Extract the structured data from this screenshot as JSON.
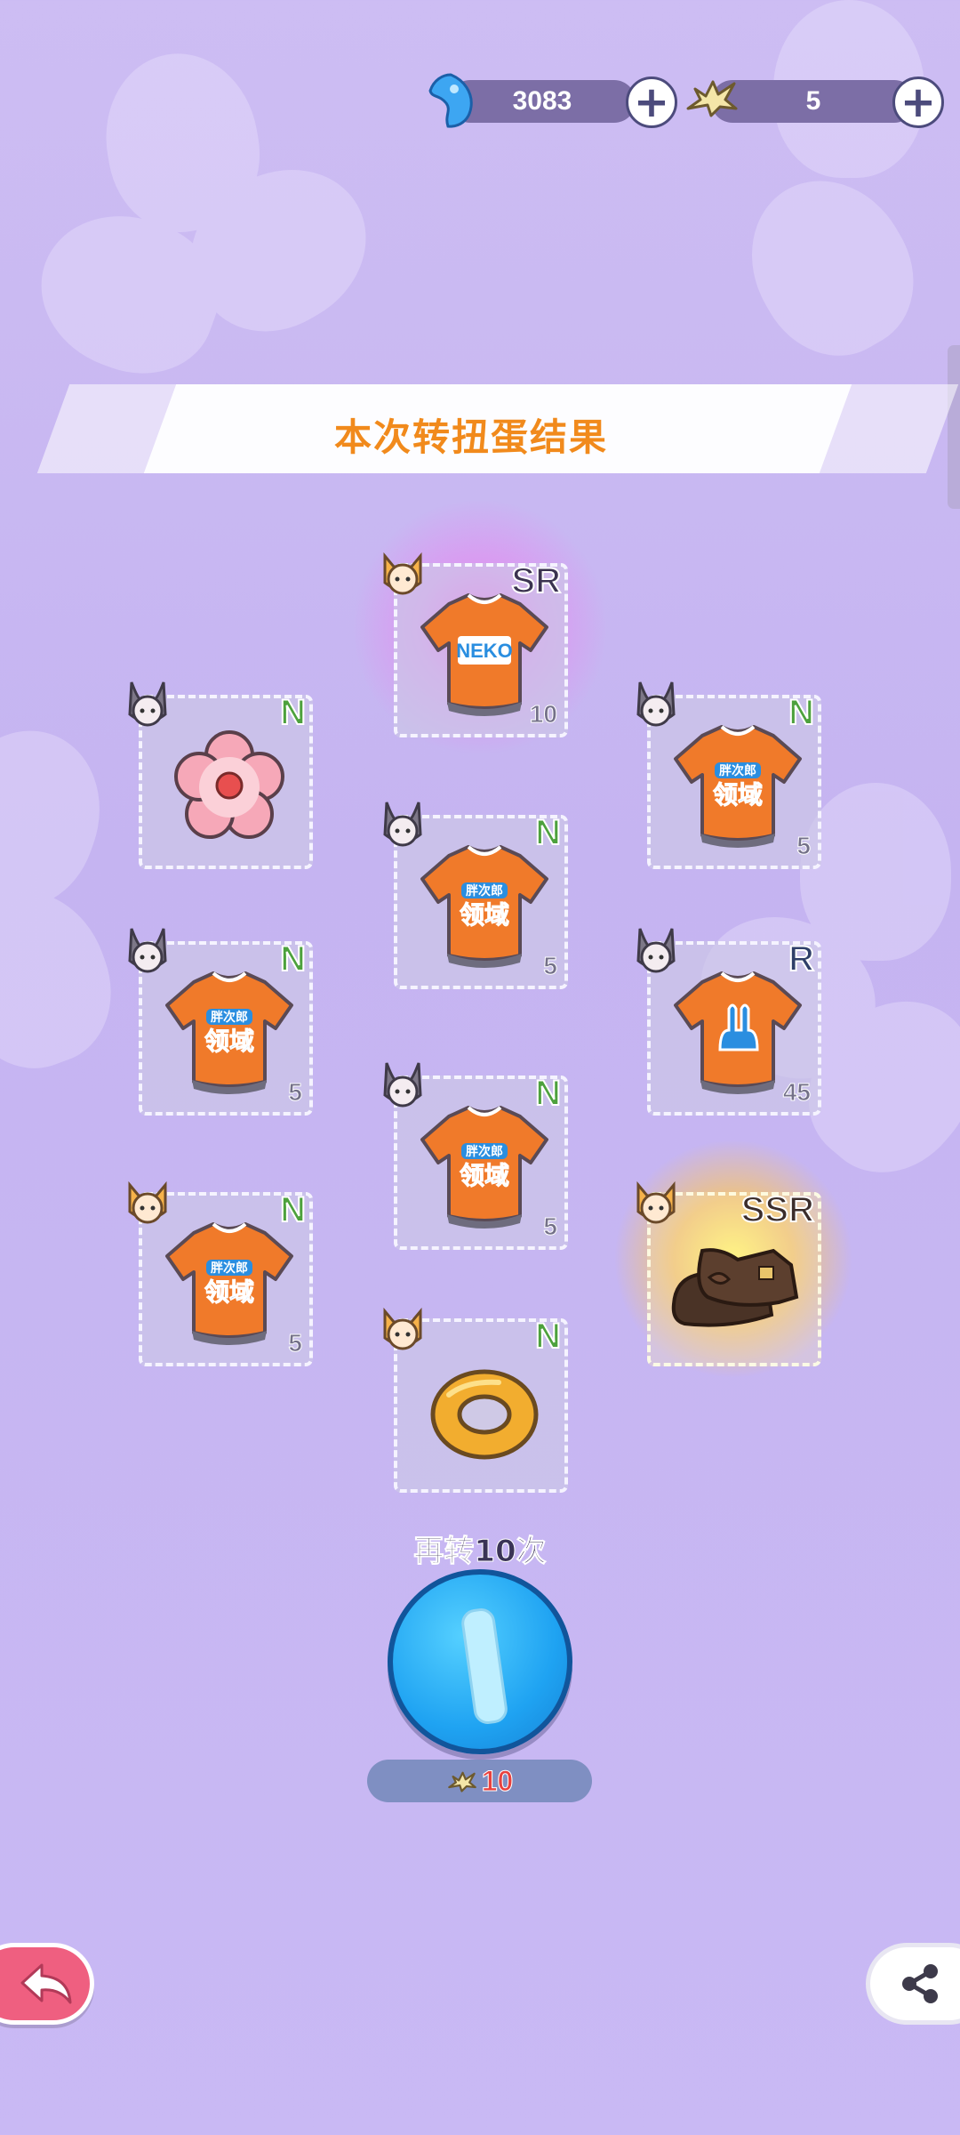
{
  "currency": {
    "gems": "3083",
    "fishbones": "5"
  },
  "banner": {
    "title": "本次转扭蛋结果"
  },
  "cards": [
    {
      "id": "c1",
      "rarity": "SR",
      "count": "10",
      "item": "neko-shirt-icon"
    },
    {
      "id": "c2",
      "rarity": "N",
      "count": "",
      "item": "flower-cookie-icon"
    },
    {
      "id": "c3",
      "rarity": "N",
      "count": "5",
      "item": "orange-shirt-icon"
    },
    {
      "id": "c4",
      "rarity": "N",
      "count": "5",
      "item": "orange-shirt-icon"
    },
    {
      "id": "c5",
      "rarity": "N",
      "count": "5",
      "item": "orange-shirt-icon"
    },
    {
      "id": "c6",
      "rarity": "R",
      "count": "45",
      "item": "bunny-shirt-icon"
    },
    {
      "id": "c7",
      "rarity": "N",
      "count": "5",
      "item": "orange-shirt-icon"
    },
    {
      "id": "c8",
      "rarity": "N",
      "count": "5",
      "item": "orange-shirt-icon"
    },
    {
      "id": "c9",
      "rarity": "SSR",
      "count": "",
      "item": "brown-shoes-icon"
    },
    {
      "id": "c10",
      "rarity": "N",
      "count": "",
      "item": "donut-ring-icon"
    }
  ],
  "again": {
    "label": "再转10次",
    "cost": "10"
  },
  "shirt_text": {
    "neko": "NEKO",
    "line1": "胖次郎",
    "line2": "领域"
  },
  "colors": {
    "shirt": "#f07a2a",
    "title": "#f18a1c",
    "back_button": "#ef5f80"
  }
}
